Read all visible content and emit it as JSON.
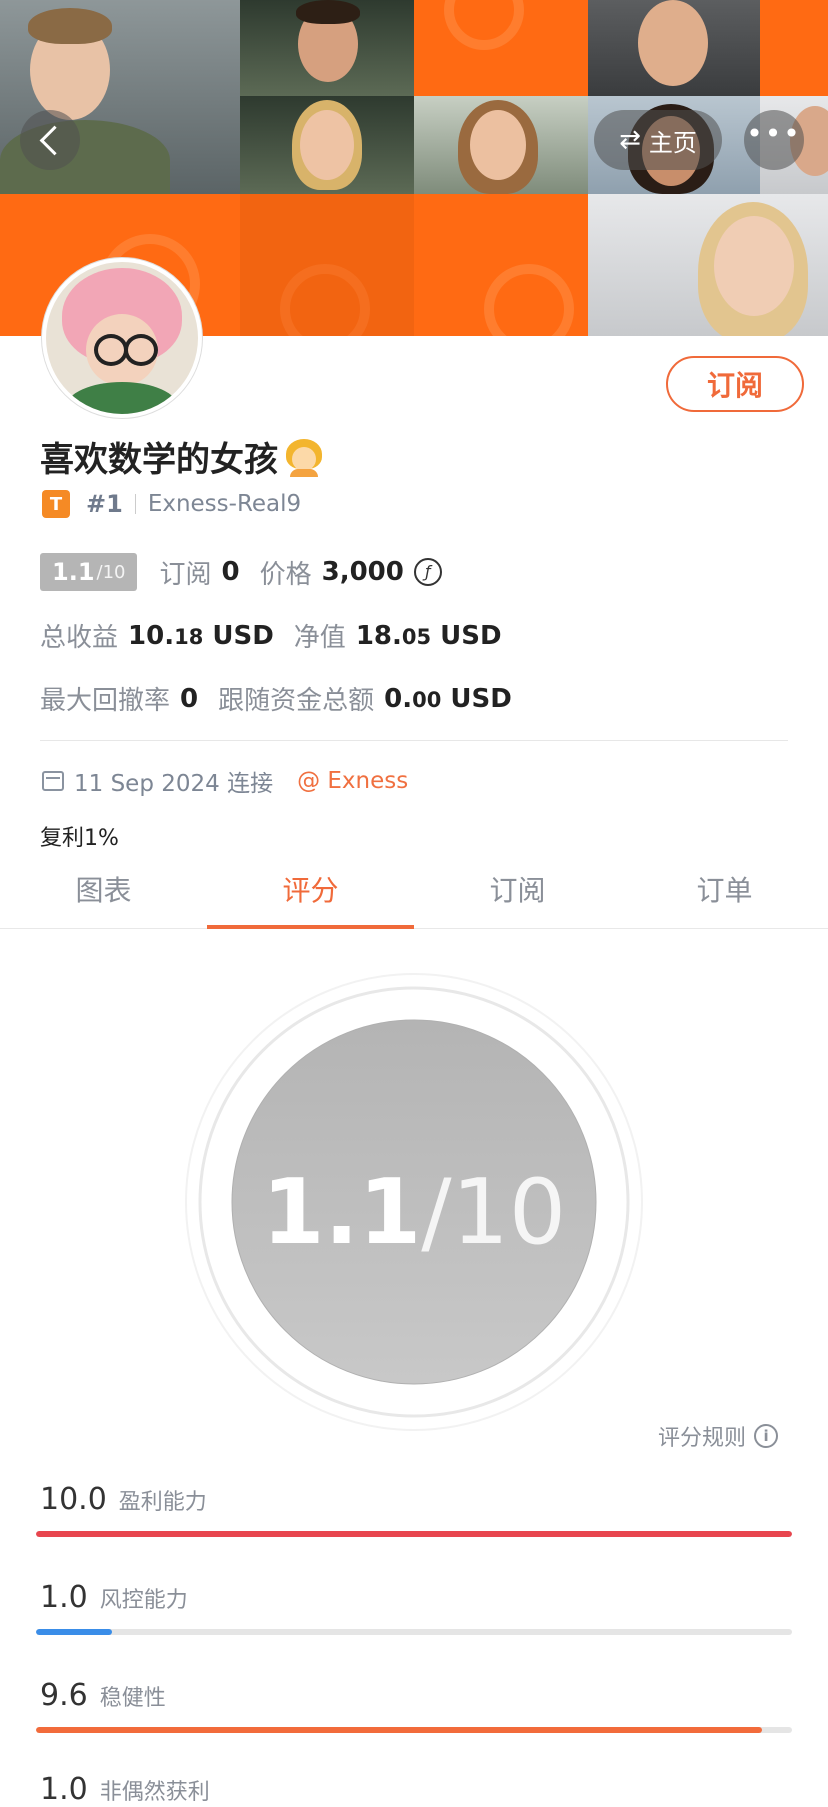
{
  "header": {
    "home_label": "主页",
    "home_icon": "swap-icon",
    "more_icon": "more-icon",
    "back_icon": "back-chevron-icon"
  },
  "profile": {
    "name": "喜欢数学的女孩",
    "rank": "#1",
    "account": "Exness-Real9",
    "badge": "T",
    "subscribe_button": "订阅"
  },
  "stats": {
    "score": "1.1",
    "score_max": "/10",
    "subscribe_label": "订阅",
    "subscribe_count": "0",
    "price_label": "价格",
    "price_value": "3,000",
    "price_icon": "ƒ",
    "total_profit_label": "总收益",
    "total_profit_int": "10.",
    "total_profit_dec": "18",
    "total_profit_unit": "USD",
    "net_value_label": "净值",
    "net_value_int": "18.",
    "net_value_dec": "05",
    "net_value_unit": "USD",
    "drawdown_label": "最大回撤率",
    "drawdown_value": "0",
    "follow_total_label": "跟随资金总额",
    "follow_total_int": "0.",
    "follow_total_dec": "00",
    "follow_total_unit": "USD"
  },
  "connection": {
    "date": "11 Sep 2024 连接",
    "broker": "@ Exness",
    "compound": "复利1%"
  },
  "tabs": [
    {
      "label": "图表"
    },
    {
      "label": "评分"
    },
    {
      "label": "订阅"
    },
    {
      "label": "订单"
    }
  ],
  "rating": {
    "score": "1.1",
    "max": "/10",
    "rules_label": "评分规则",
    "metrics": [
      {
        "value": "10.0",
        "label": "盈利能力",
        "fraction": 1.0,
        "color": "#e8454e"
      },
      {
        "value": "1.0",
        "label": "风控能力",
        "fraction": 0.1,
        "color": "#3a8de8"
      },
      {
        "value": "9.6",
        "label": "稳健性",
        "fraction": 0.96,
        "color": "#f26b3b"
      },
      {
        "value": "1.0",
        "label": "非偶然获利",
        "fraction": 0.1,
        "color": "#3a8de8"
      }
    ]
  },
  "colors": {
    "accent": "#f06a3a",
    "banner_orange": "#ff6a13",
    "score_chip": "#b5b5b5"
  }
}
